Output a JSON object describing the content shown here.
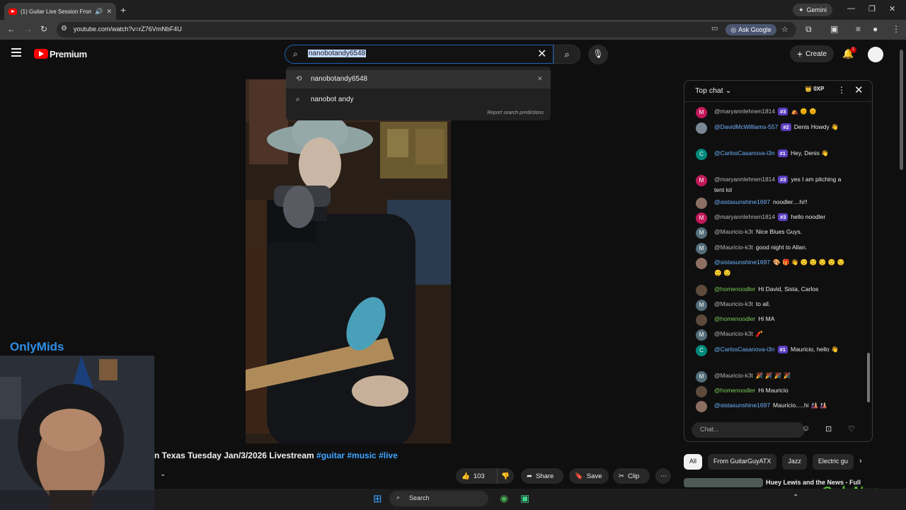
{
  "browser": {
    "tab_title": "(1) Guitar Live Session From",
    "new_tab": "+",
    "gemini_label": "Gemini",
    "url": "youtube.com/watch?v=rZ76VmNbF4U",
    "ask_google": "Ask Google"
  },
  "header": {
    "brand": "Premium",
    "search_value": "nanobotandy6548",
    "create_label": "Create",
    "notif_count": "1"
  },
  "suggestions": {
    "items": [
      {
        "text": "nanobotandy6548",
        "icon": "history-icon"
      },
      {
        "text": "nanobot andy",
        "icon": "search-icon"
      }
    ],
    "report": "Report search predictions"
  },
  "video": {
    "title": "n Texas Tuesday Jan/3/2026 Livestream",
    "tags": "#guitar #music #live",
    "likes": "103",
    "share": "Share",
    "save": "Save",
    "clip": "Clip"
  },
  "chat": {
    "header": "Top chat",
    "xp": "0XP",
    "placeholder": "Chat...",
    "messages": [
      {
        "author": "@maryannlehnen1814",
        "badge": "#3",
        "text": "⛺ 🌞 🌞",
        "initial": "M",
        "color": "#c2185b",
        "style": "normal"
      },
      {
        "author": "@DavidMcWilliams-557",
        "badge": "#2",
        "text": "Denis Howdy 👋",
        "initial": "",
        "color": "#7b8794",
        "style": "member"
      },
      {
        "author": "@CarlosCasanova-i3n",
        "badge": "#1",
        "text": "Hey, Denis 👋",
        "initial": "C",
        "color": "#00897b",
        "style": "member"
      },
      {
        "author": "@maryannlehnen1814",
        "badge": "#3",
        "text": "yes I am pitching a tent lol",
        "initial": "M",
        "color": "#c2185b",
        "style": "normal"
      },
      {
        "author": "@sistasunshine1697",
        "badge": "",
        "text": "noodler....hi!!",
        "initial": "",
        "color": "#8d6e63",
        "style": "member"
      },
      {
        "author": "@maryannlehnen1814",
        "badge": "#3",
        "text": "hello noodler",
        "initial": "M",
        "color": "#c2185b",
        "style": "normal"
      },
      {
        "author": "@Mauricio-k3t",
        "badge": "",
        "text": "Nice Blues Guys.",
        "initial": "M",
        "color": "#546e7a",
        "style": "normal"
      },
      {
        "author": "@Mauricio-k3t",
        "badge": "",
        "text": "good night to Allan.",
        "initial": "M",
        "color": "#546e7a",
        "style": "normal"
      },
      {
        "author": "@sistasunshine1697",
        "badge": "",
        "text": "🎨 🎁 👋 😌 😌 😌 😌 😌 😌 😌",
        "initial": "",
        "color": "#8d6e63",
        "style": "member"
      },
      {
        "author": "@homenoodler",
        "badge": "",
        "text": "Hi David, Sista, Carlos",
        "initial": "",
        "color": "#5d4a3a",
        "style": "green"
      },
      {
        "author": "@Mauricio-k3t",
        "badge": "",
        "text": "to all.",
        "initial": "M",
        "color": "#546e7a",
        "style": "normal"
      },
      {
        "author": "@homenoodler",
        "badge": "",
        "text": "Hi MA",
        "initial": "",
        "color": "#5d4a3a",
        "style": "green"
      },
      {
        "author": "@Mauricio-k3t",
        "badge": "",
        "text": "🧨",
        "initial": "M",
        "color": "#546e7a",
        "style": "normal"
      },
      {
        "author": "@CarlosCasanova-i3n",
        "badge": "#1",
        "text": "Mauricio, hello 👋",
        "initial": "C",
        "color": "#00897b",
        "style": "member"
      },
      {
        "author": "@Mauricio-k3t",
        "badge": "",
        "text": "🎉 🎉 🎉 🎉",
        "initial": "M",
        "color": "#546e7a",
        "style": "normal"
      },
      {
        "author": "@homenoodler",
        "badge": "",
        "text": "Hi Mauricio",
        "initial": "",
        "color": "#5d4a3a",
        "style": "green"
      },
      {
        "author": "@sistasunshine1697",
        "badge": "",
        "text": "Mauricio.....hi 🎎 🎎",
        "initial": "",
        "color": "#8d6e63",
        "style": "member"
      }
    ]
  },
  "chips": [
    "All",
    "From GuitarGuyATX",
    "Jazz",
    "Electric gu"
  ],
  "related": {
    "title": "Huey Lewis and the News - Full"
  },
  "overlays": {
    "onlymids": "OnlyMids",
    "onlynuz": "OnlyNuz"
  },
  "taskbar": {
    "search": "Search"
  },
  "colors": {
    "accent": "#3ea6ff",
    "brand_red": "#ff0000",
    "member_badge": "#5a3ec0"
  }
}
